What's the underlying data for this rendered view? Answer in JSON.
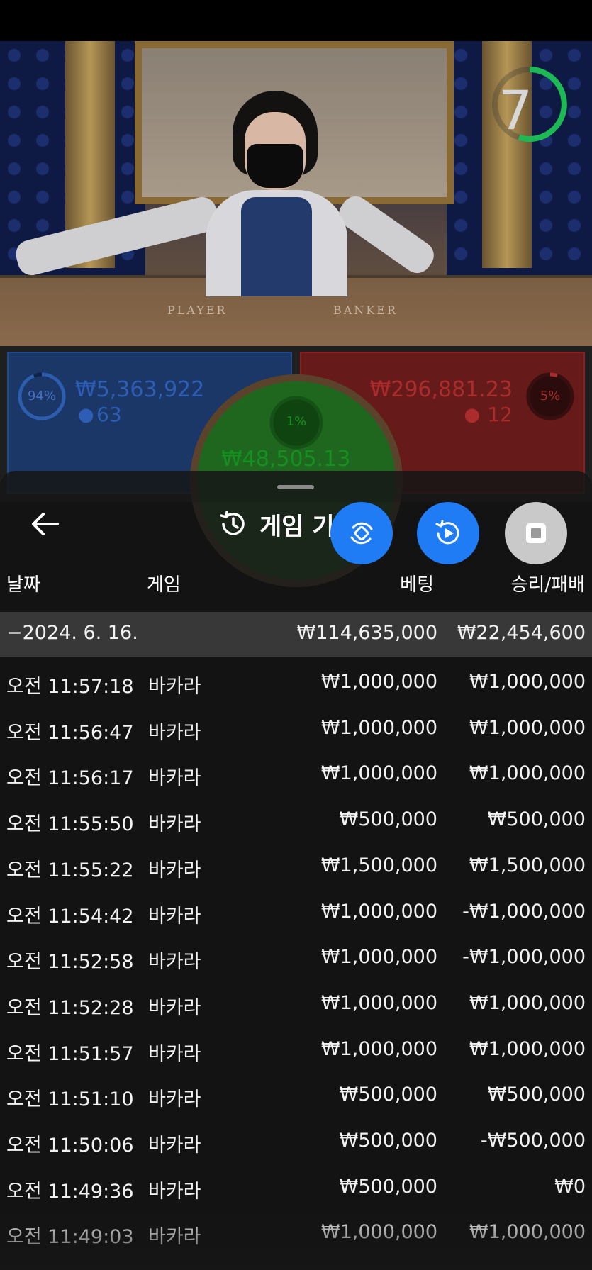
{
  "timer": {
    "value": "7",
    "ring_color": "#1db954"
  },
  "table_text": {
    "player": "PLAYER",
    "banker": "BANKER"
  },
  "bets": {
    "player": {
      "percent": "94%",
      "amount": "₩5,363,922",
      "count": "63",
      "color": "#2f6bd4"
    },
    "banker": {
      "percent": "5%",
      "amount": "₩296,881.23",
      "count": "12",
      "color": "#d42f2f"
    },
    "tie": {
      "percent": "1%",
      "amount": "₩48,505.13",
      "color": "#1dbf2a"
    }
  },
  "sheet": {
    "title": "게임 기",
    "back_icon": "arrow-left-icon",
    "history_icon": "history-clock-icon",
    "fab_buttons": [
      {
        "icon": "switch-table-icon",
        "color": "#1f7cf5"
      },
      {
        "icon": "replay-icon",
        "color": "#1f7cf5"
      },
      {
        "icon": "stop-square-icon",
        "color": "#c9c9c9"
      }
    ],
    "headers": {
      "date": "날짜",
      "game": "게임",
      "bet": "베팅",
      "result": "승리/패배"
    },
    "group": {
      "label": "−2024. 6. 16.",
      "bet_total": "₩114,635,000",
      "result_total": "₩22,454,600"
    },
    "rows": [
      {
        "time": "오전 11:57:18",
        "game": "바카라",
        "bet": "₩1,000,000",
        "result": "₩1,000,000"
      },
      {
        "time": "오전 11:56:47",
        "game": "바카라",
        "bet": "₩1,000,000",
        "result": "₩1,000,000"
      },
      {
        "time": "오전 11:56:17",
        "game": "바카라",
        "bet": "₩1,000,000",
        "result": "₩1,000,000"
      },
      {
        "time": "오전 11:55:50",
        "game": "바카라",
        "bet": "₩500,000",
        "result": "₩500,000"
      },
      {
        "time": "오전 11:55:22",
        "game": "바카라",
        "bet": "₩1,500,000",
        "result": "₩1,500,000"
      },
      {
        "time": "오전 11:54:42",
        "game": "바카라",
        "bet": "₩1,000,000",
        "result": "-₩1,000,000"
      },
      {
        "time": "오전 11:52:58",
        "game": "바카라",
        "bet": "₩1,000,000",
        "result": "-₩1,000,000"
      },
      {
        "time": "오전 11:52:28",
        "game": "바카라",
        "bet": "₩1,000,000",
        "result": "₩1,000,000"
      },
      {
        "time": "오전 11:51:57",
        "game": "바카라",
        "bet": "₩1,000,000",
        "result": "₩1,000,000"
      },
      {
        "time": "오전 11:51:10",
        "game": "바카라",
        "bet": "₩500,000",
        "result": "₩500,000"
      },
      {
        "time": "오전 11:50:06",
        "game": "바카라",
        "bet": "₩500,000",
        "result": "-₩500,000"
      },
      {
        "time": "오전 11:49:36",
        "game": "바카라",
        "bet": "₩500,000",
        "result": "₩0"
      },
      {
        "time": "오전 11:49:03",
        "game": "바카라",
        "bet": "₩1,000,000",
        "result": "₩1,000,000"
      }
    ]
  }
}
